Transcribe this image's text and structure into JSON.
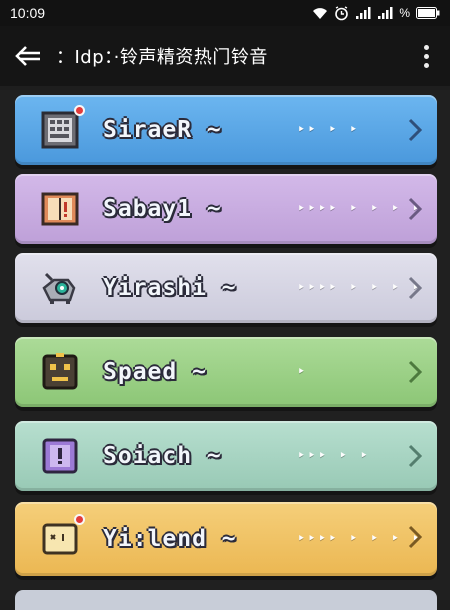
{
  "status": {
    "time": "10:09",
    "battery": "%",
    "icons": [
      "wifi-icon",
      "alarm-icon",
      "signal-icon",
      "signal-icon",
      "battery-icon"
    ]
  },
  "appbar": {
    "title": "：Idp：·铃声精资热门铃音",
    "back_icon": "back-arrow-icon",
    "more_icon": "more-vertical-icon"
  },
  "items": [
    {
      "name": "SiraeR ~",
      "dots": "‣‣ ‣ ‣",
      "icon": "keypad-icon",
      "badge": true,
      "color": "#57a6e8"
    },
    {
      "name": "Sabay1 ~",
      "dots": "‣‣‣‣ ‣ ‣ ‣ ‣",
      "icon": "book-icon",
      "badge": false,
      "color": "#c7aadf"
    },
    {
      "name": "Yirashi ~",
      "dots": "‣‣‣‣ ‣ ‣ ‣ ‣",
      "icon": "robot-creature-icon",
      "badge": false,
      "color": "#d6d5e4"
    },
    {
      "name": "Spaed ~",
      "dots": "‣",
      "icon": "robot-face-icon",
      "badge": false,
      "color": "#9fd28b"
    },
    {
      "name": "Soiach ~",
      "dots": "‣‣‣ ‣ ‣",
      "icon": "alert-box-icon",
      "badge": false,
      "color": "#a9d6c3"
    },
    {
      "name": "Yi:lend ~",
      "dots": "‣‣‣‣ ‣ ‣ ‣ ‣",
      "icon": "note-icon",
      "badge": true,
      "color": "#f0c467"
    }
  ]
}
